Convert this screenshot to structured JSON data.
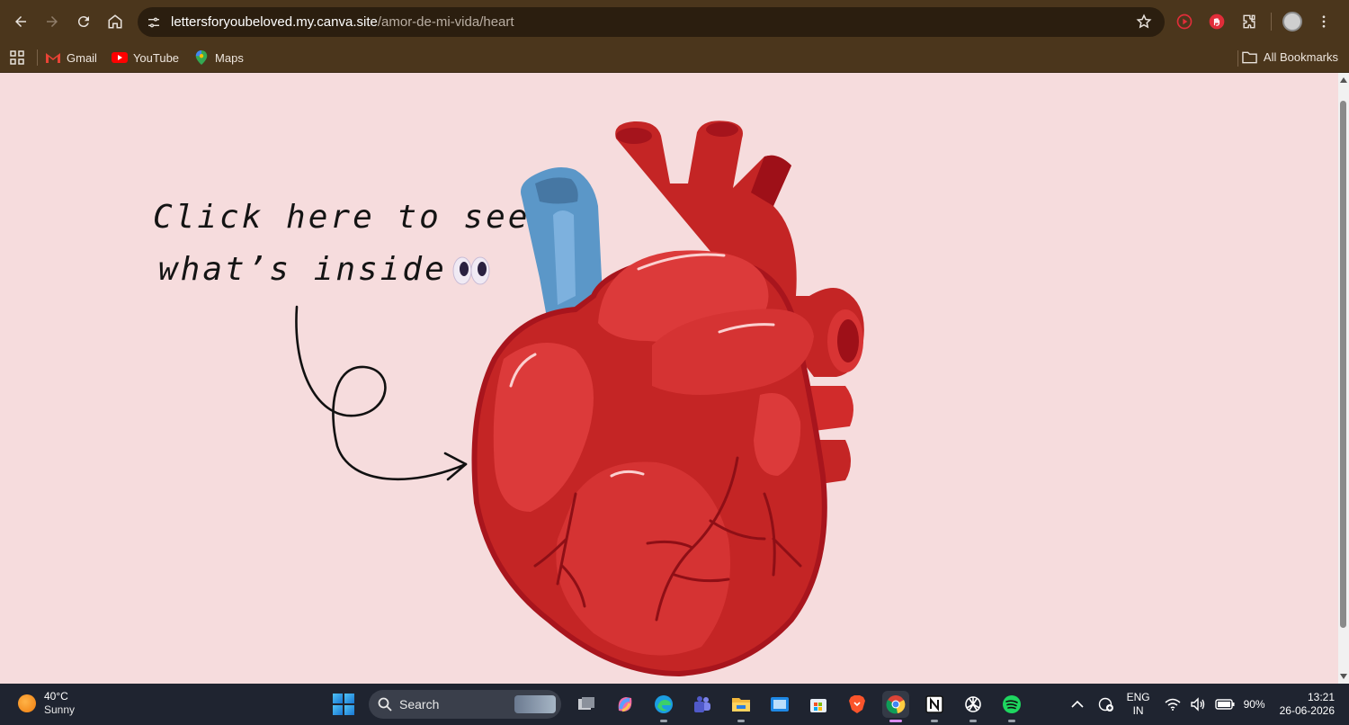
{
  "browser": {
    "url_host": "lettersforyoubeloved.my.canva.site",
    "url_path": "/amor-de-mi-vida/heart",
    "bookmarks": [
      {
        "label": "Gmail",
        "icon": "gmail-icon"
      },
      {
        "label": "YouTube",
        "icon": "youtube-icon"
      },
      {
        "label": "Maps",
        "icon": "maps-icon"
      }
    ],
    "all_bookmarks_label": "All Bookmarks"
  },
  "page": {
    "line1": "Click here to see",
    "line2": "what’s inside",
    "background": "#f6dcdd"
  },
  "taskbar": {
    "weather_temp": "40°C",
    "weather_cond": "Sunny",
    "search_label": "Search",
    "lang_top": "ENG",
    "lang_bottom": "IN",
    "battery": "90%",
    "time": "13:21",
    "date": "26-06-2026"
  }
}
